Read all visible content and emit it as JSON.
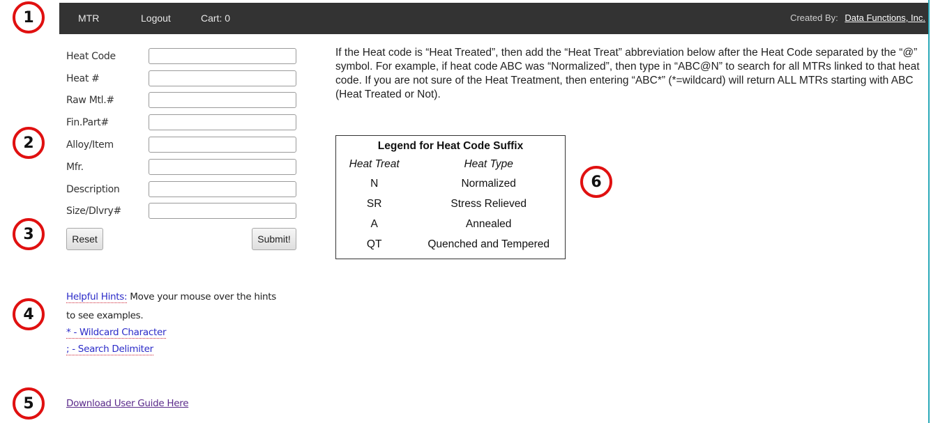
{
  "navbar": {
    "links": [
      "MTR",
      "Logout",
      "Cart: 0"
    ],
    "created_by_label": "Created By:",
    "company": "Data Functions, Inc."
  },
  "callouts": [
    "1",
    "2",
    "3",
    "4",
    "5",
    "6"
  ],
  "form": {
    "fields": [
      {
        "label": "Heat Code",
        "value": ""
      },
      {
        "label": "Heat #",
        "value": ""
      },
      {
        "label": "Raw Mtl.#",
        "value": ""
      },
      {
        "label": "Fin.Part#",
        "value": ""
      },
      {
        "label": "Alloy/Item",
        "value": ""
      },
      {
        "label": "Mfr.",
        "value": ""
      },
      {
        "label": "Description",
        "value": ""
      },
      {
        "label": "Size/Dlvry#",
        "value": ""
      }
    ],
    "reset_label": "Reset",
    "submit_label": "Submit!"
  },
  "hints": {
    "title": "Helpful Hints:",
    "text_line1": " Move your mouse over the hints",
    "text_line2": "to see examples.",
    "items": [
      "* - Wildcard Character",
      "; - Search Delimiter"
    ]
  },
  "user_guide_link": "Download User Guide Here",
  "instructions": "If the Heat code is “Heat Treated”, then add the “Heat Treat” abbreviation below after the Heat Code separated by the “@” symbol. For example, if heat code ABC was “Normalized”, then type in “ABC@N” to search for all MTRs linked to that heat code. If you are not sure of the Heat Treatment, then entering “ABC*” (*=wildcard) will return ALL MTRs starting with ABC (Heat Treated or Not).",
  "legend": {
    "title": "Legend for Heat Code Suffix",
    "headers": [
      "Heat Treat",
      "Heat Type"
    ],
    "rows": [
      [
        "N",
        "Normalized"
      ],
      [
        "SR",
        "Stress Relieved"
      ],
      [
        "A",
        "Annealed"
      ],
      [
        "QT",
        "Quenched and Tempered"
      ]
    ]
  },
  "colors": {
    "navbar_bg": "#333333",
    "callout_border": "#e01010",
    "hint_link": "#2b2bc8",
    "visited_link": "#5a2a8a",
    "right_edge": "#29a8b8"
  }
}
